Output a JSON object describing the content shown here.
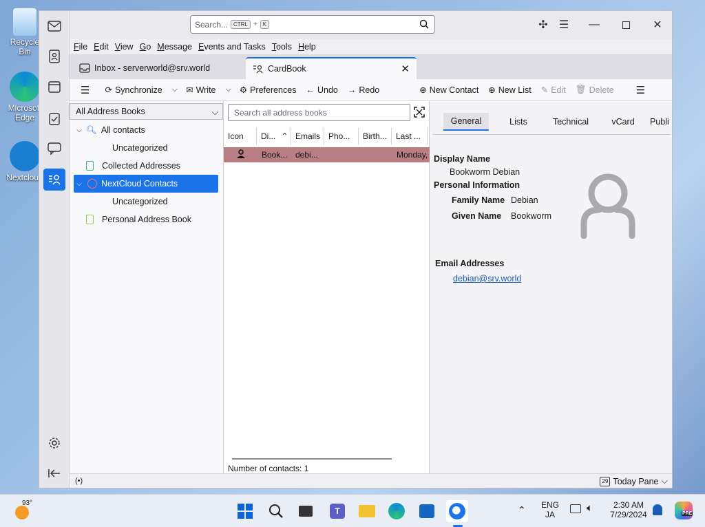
{
  "desktop": {
    "icons": [
      {
        "label": "Recycle Bin",
        "icon": "recycle-bin-icon"
      },
      {
        "label": "Microsoft Edge",
        "icon": "edge-icon"
      },
      {
        "label": "Nextcloud",
        "icon": "nextcloud-icon"
      }
    ]
  },
  "titlebar": {
    "search_placeholder": "Search...",
    "shortcut_mod": "CTRL",
    "shortcut_plus": "+",
    "shortcut_key": "K"
  },
  "menu": [
    "File",
    "Edit",
    "View",
    "Go",
    "Message",
    "Events and Tasks",
    "Tools",
    "Help"
  ],
  "tabs": {
    "inbox": "Inbox - serverworld@srv.world",
    "cardbook": "CardBook"
  },
  "toolbar": {
    "synchronize": "Synchronize",
    "write": "Write",
    "preferences": "Preferences",
    "undo": "Undo",
    "redo": "Redo",
    "new_contact": "New Contact",
    "new_list": "New List",
    "edit": "Edit",
    "delete": "Delete"
  },
  "tree": {
    "selector": "All Address Books",
    "items": [
      {
        "label": "All contacts"
      },
      {
        "label": "Uncategorized"
      },
      {
        "label": "Collected Addresses"
      },
      {
        "label": "NextCloud Contacts"
      },
      {
        "label": "Uncategorized"
      },
      {
        "label": "Personal Address Book"
      }
    ]
  },
  "list": {
    "search_placeholder": "Search all address books",
    "columns": [
      "Icon",
      "Di...",
      "Emails",
      "Pho...",
      "Birth...",
      "Last ..."
    ],
    "rows": [
      {
        "display": "Book...",
        "email": "debi...",
        "last": "Monday,"
      }
    ],
    "count_label": "Number of contacts: 1"
  },
  "detail": {
    "tabs": [
      "General",
      "Lists",
      "Technical",
      "vCard",
      "Publi"
    ],
    "display_name_label": "Display Name",
    "display_name": "Bookworm Debian",
    "personal_info_label": "Personal Information",
    "family_name_label": "Family Name",
    "family_name": "Debian",
    "given_name_label": "Given Name",
    "given_name": "Bookworm",
    "email_label": "Email Addresses",
    "email": "debian@srv.world"
  },
  "statusbar": {
    "today_pane": "Today Pane",
    "calendar_day": "29"
  },
  "taskbar": {
    "weather_temp": "93°",
    "lang_top": "ENG",
    "lang_bottom": "JA",
    "time": "2:30 AM",
    "date": "7/29/2024",
    "copilot_badge": "PRE"
  },
  "colors": {
    "accent": "#1a73e8",
    "selected_row": "#b87e82"
  }
}
